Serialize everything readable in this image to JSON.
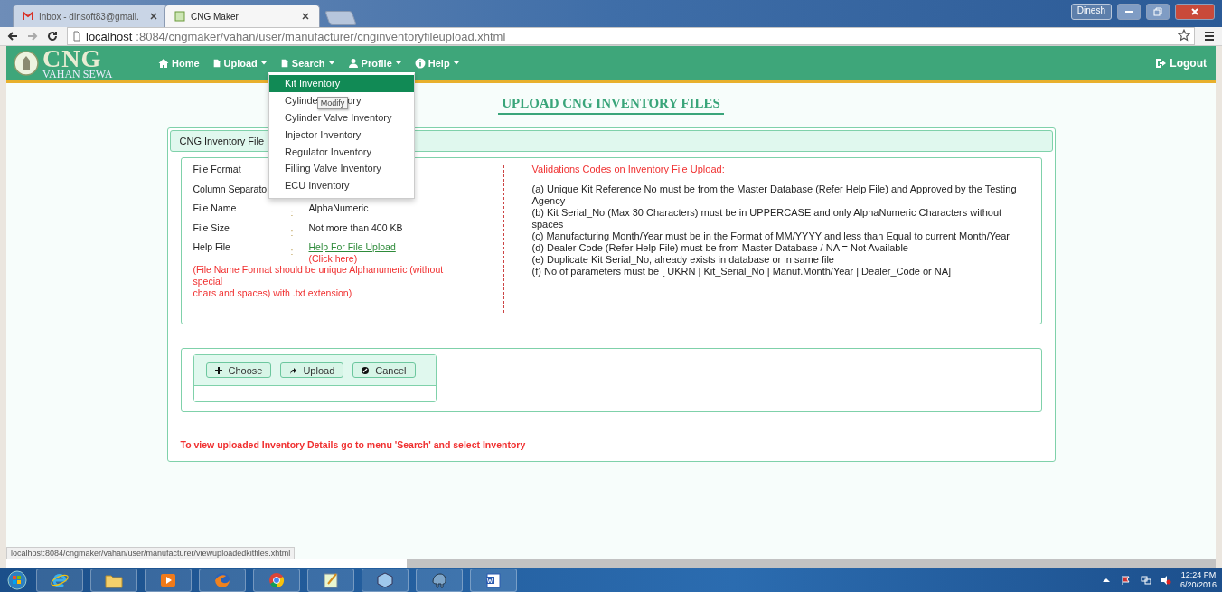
{
  "browser": {
    "tabs": [
      {
        "title": "Inbox - dinsoft83@gmail.",
        "kind": "mail",
        "selected": false
      },
      {
        "title": "CNG Maker",
        "kind": "site",
        "selected": true
      }
    ],
    "user": "Dinesh",
    "url_host": "localhost",
    "url_path": ":8084/cngmaker/vahan/user/manufacturer/cnginventoryfileupload.xhtml",
    "status_url": "localhost:8084/cngmaker/vahan/user/manufacturer/viewuploadedkitfiles.xhtml"
  },
  "header": {
    "logo_title": "CNG",
    "logo_subtitle": "VAHAN SEWA",
    "logout": "Logout",
    "nav": [
      {
        "label": "Home",
        "kind": "home",
        "dropdown": false
      },
      {
        "label": "Upload",
        "kind": "file",
        "dropdown": true
      },
      {
        "label": "Search",
        "kind": "file",
        "dropdown": true
      },
      {
        "label": "Profile",
        "kind": "user",
        "dropdown": true
      },
      {
        "label": "Help",
        "kind": "info",
        "dropdown": true
      }
    ]
  },
  "search_menu": {
    "items": [
      {
        "label": "Kit Inventory",
        "selected": true
      },
      {
        "label": "Cylinde",
        "tooltip": "Modify",
        "label_after": "ory",
        "selected": false
      },
      {
        "label": "Cylinder Valve Inventory",
        "selected": false
      },
      {
        "label": "Injector Inventory",
        "selected": false
      },
      {
        "label": "Regulator Inventory",
        "selected": false
      },
      {
        "label": "Filling Valve Inventory",
        "selected": false
      },
      {
        "label": "ECU Inventory",
        "selected": false
      }
    ]
  },
  "page_title": "UPLOAD CNG INVENTORY FILES",
  "panel_title": "CNG Inventory File",
  "file_rules": [
    {
      "label": "File Format"
    },
    {
      "label": "Column Separato"
    },
    {
      "label": "File Name",
      "separator": ":",
      "value": "AlphaNumeric",
      "kind": "text"
    },
    {
      "label": "File Size",
      "separator": ":",
      "value": "Not more than 400 KB",
      "kind": "text"
    },
    {
      "label": "Help File",
      "separator": ":",
      "value": "Help For File Upload",
      "kind": "link",
      "hint": "(Click here)"
    }
  ],
  "file_note_lines": [
    "(File Name Format should be unique Alphanumeric (without",
    "special",
    "chars and spaces) with .txt extension)"
  ],
  "validations_title": "Validations Codes on Inventory File Upload:",
  "validations": [
    "(a) Unique Kit Reference No must be from the Master Database (Refer Help File) and Approved by the Testing Agency",
    "(b) Kit Serial_No (Max 30 Characters) must be in UPPERCASE and only AlphaNumeric Characters without spaces",
    "(c) Manufacturing Month/Year must be in the Format of MM/YYYY and less than Equal to current Month/Year",
    "(d) Dealer Code (Refer Help File) must be from Master Database / NA = Not Available",
    "(e) Duplicate Kit Serial_No, already exists in database or in same file",
    "(f) No of parameters must be [ UKRN | Kit_Serial_No | Manuf.Month/Year | Dealer_Code or NA]"
  ],
  "upload_buttons": [
    {
      "label": "Choose",
      "kind": "add"
    },
    {
      "label": "Upload",
      "kind": "upload"
    },
    {
      "label": "Cancel",
      "kind": "cancel"
    }
  ],
  "footer_note": "To view uploaded Inventory Details go to menu 'Search' and select Inventory",
  "taskbar": {
    "apps": [
      {
        "kind": "ie"
      },
      {
        "kind": "folder"
      },
      {
        "kind": "media"
      },
      {
        "kind": "firefox"
      },
      {
        "kind": "chrome"
      },
      {
        "kind": "notepad"
      },
      {
        "kind": "box"
      },
      {
        "kind": "elephant"
      },
      {
        "kind": "word"
      }
    ],
    "time": "12:24 PM",
    "date": "6/20/2016"
  }
}
